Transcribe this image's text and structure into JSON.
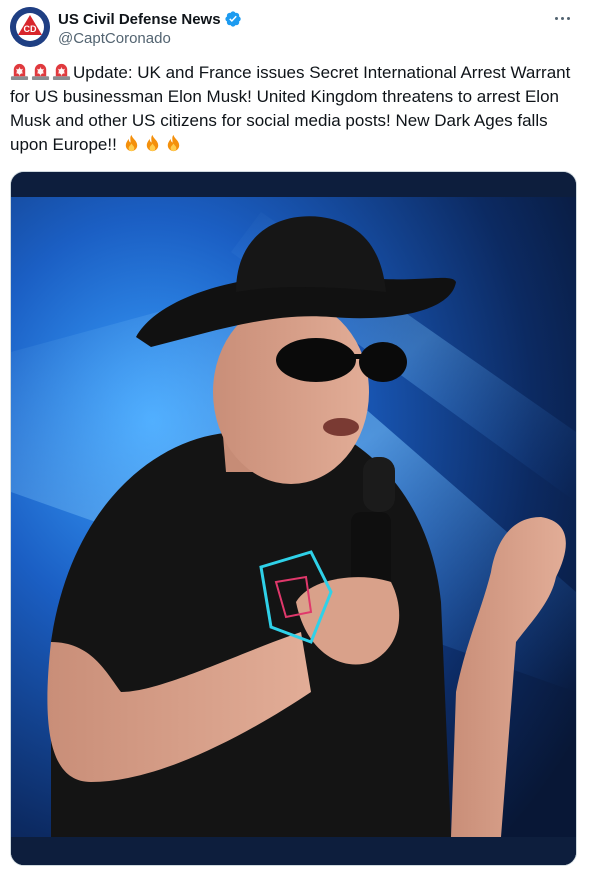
{
  "author": {
    "display_name": "US Civil Defense News",
    "handle": "@CaptCoronado",
    "verified": true,
    "avatar_letters": "CD"
  },
  "tweet": {
    "prefix_emojis": [
      "rotating-light",
      "rotating-light",
      "rotating-light"
    ],
    "text": "Update: UK and France issues Secret International Arrest Warrant for US businessman Elon Musk! United Kingdom threatens to arrest Elon Musk and other US citizens for social media posts! New Dark Ages falls upon Europe!! ",
    "suffix_emojis": [
      "fire",
      "fire",
      "fire"
    ]
  },
  "icons": {
    "more": "more-options-icon",
    "verified": "verified-badge-icon"
  },
  "colors": {
    "verified_blue": "#1d9bf0",
    "handle_gray": "#536471",
    "text": "#0f1419",
    "avatar_bg": "#1f3f83",
    "avatar_triangle": "#d8262c"
  },
  "media": {
    "type": "photo"
  }
}
